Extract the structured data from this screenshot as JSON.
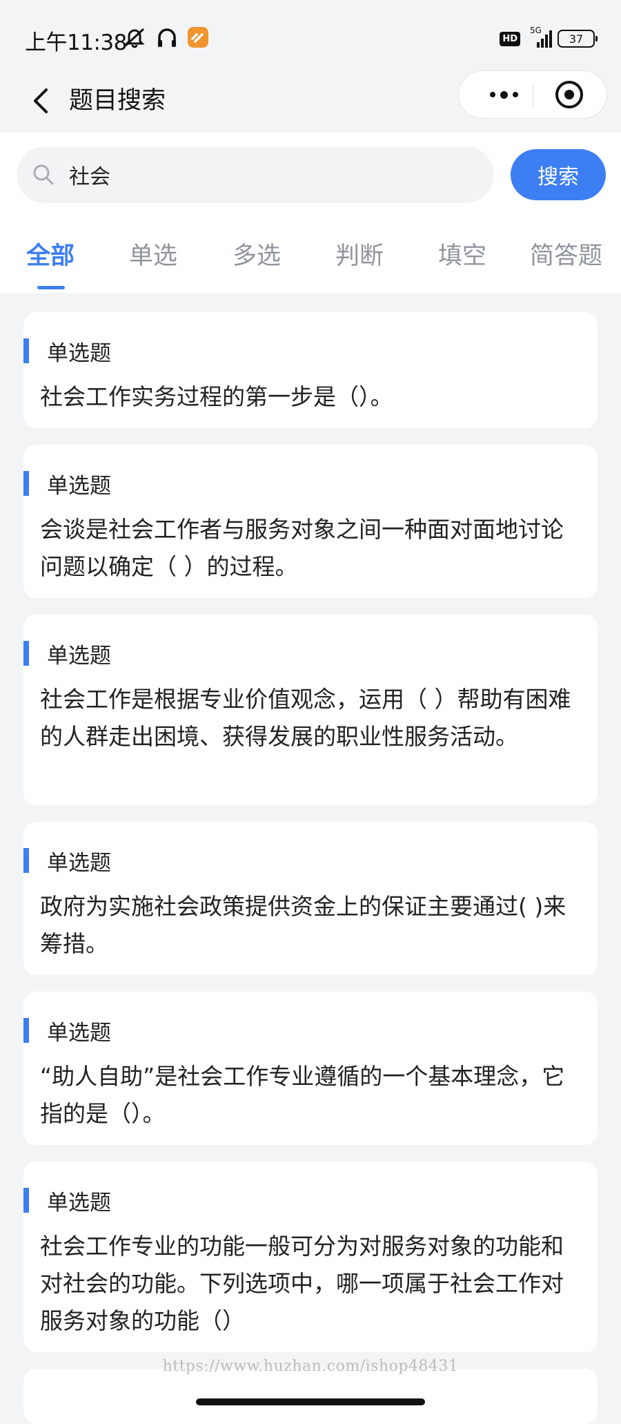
{
  "status_bar": {
    "time": "上午11:38",
    "hd": "HD",
    "network": "5G",
    "battery": "37"
  },
  "nav": {
    "title": "题目搜索"
  },
  "search": {
    "value": "社会",
    "button_label": "搜索"
  },
  "tabs": [
    {
      "label": "全部",
      "active": true
    },
    {
      "label": "单选",
      "active": false
    },
    {
      "label": "多选",
      "active": false
    },
    {
      "label": "判断",
      "active": false
    },
    {
      "label": "填空",
      "active": false
    },
    {
      "label": "简答题",
      "active": false
    }
  ],
  "questions": [
    {
      "type": "单选题",
      "text": "社会工作实务过程的第一步是（）。"
    },
    {
      "type": "单选题",
      "text": "会谈是社会工作者与服务对象之间一种面对面地讨论问题以确定（ ）的过程。"
    },
    {
      "type": "单选题",
      "text": "社会工作是根据专业价值观念，运用（ ）帮助有困难的人群走出困境、获得发展的职业性服务活动。"
    },
    {
      "type": "单选题",
      "text": "政府为实施社会政策提供资金上的保证主要通过( )来筹措。"
    },
    {
      "type": "单选题",
      "text": "“助人自助”是社会工作专业遵循的一个基本理念，它指的是（）。"
    },
    {
      "type": "单选题",
      "text": "社会工作专业的功能一般可分为对服务对象的功能和对社会的功能。下列选项中，哪一项属于社会工作对服务对象的功能（）"
    }
  ],
  "watermark": "https://www.huzhan.com/ishop48431",
  "colors": {
    "accent": "#3d7ef2",
    "background": "#f3f4f6",
    "card": "#ffffff"
  }
}
